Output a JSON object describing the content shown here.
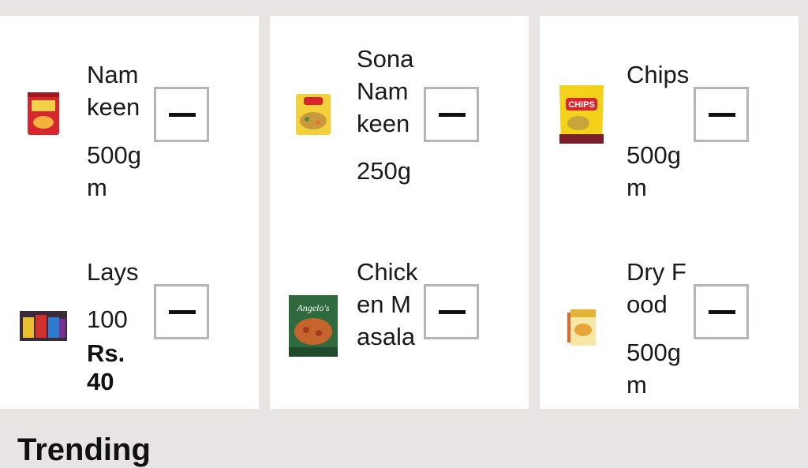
{
  "products": [
    {
      "name": "Namkeen",
      "qty": "500gm",
      "image": "namkeen-pack-image"
    },
    {
      "name": "Sona Namkeen",
      "qty": "250g",
      "image": "sona-namkeen-pack-image"
    },
    {
      "name": "Chips",
      "qty": "500gm",
      "image": "chips-pack-image",
      "pack_text": "CHIPS"
    },
    {
      "name": "Lays",
      "qty": "100",
      "price": "Rs. 40",
      "image": "lays-packs-image"
    },
    {
      "name": "Chicken Masala",
      "qty": "",
      "image": "chicken-masala-box-image",
      "pack_text": "Angelo's"
    },
    {
      "name": "Dry Food",
      "qty": "500gm",
      "image": "dry-food-box-image"
    }
  ],
  "section": {
    "title": "Trending"
  },
  "colors": {
    "background": "#e8e4e3",
    "card": "#ffffff",
    "button_border": "#b8b3b4"
  }
}
